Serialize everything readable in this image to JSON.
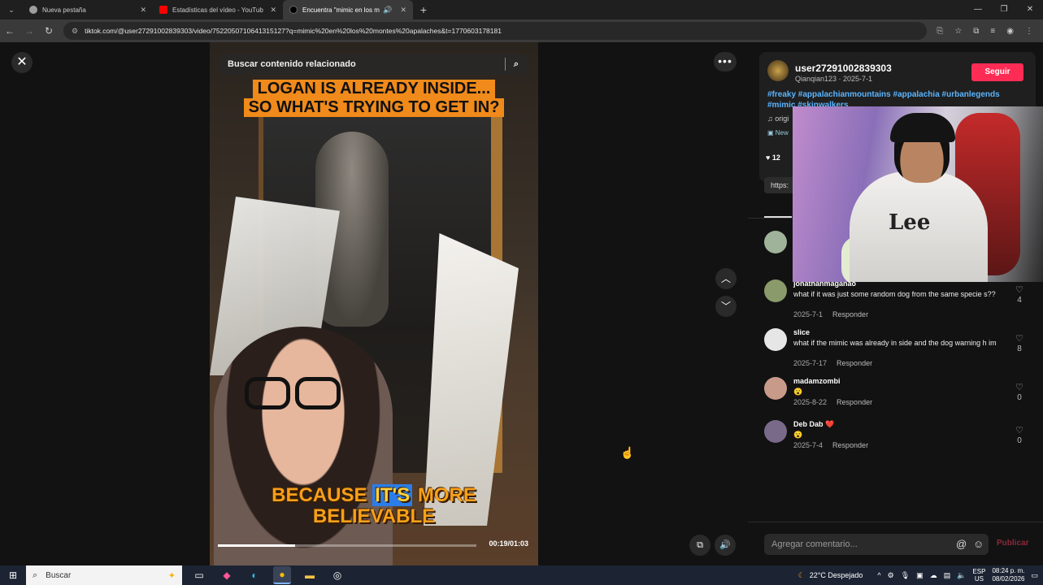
{
  "browser": {
    "tabs": [
      {
        "title": "Nueva pestaña",
        "close": "✕",
        "favicon_color": "#9e9e9e",
        "active": false
      },
      {
        "title": "Estadísticas del vídeo - YouTub",
        "close": "✕",
        "favicon_color": "#ff0000",
        "active": false
      },
      {
        "title": "Encuentra \"mimic en los mo",
        "close": "✕",
        "favicon_color": "#000000",
        "active": true
      }
    ],
    "new_tab": "+",
    "url": "tiktok.com/@user27291002839303/video/7522050710641315127?q=mimic%20en%20los%20montes%20apalaches&t=1770603178181"
  },
  "video": {
    "search_placeholder": "Buscar contenido relacionado",
    "caption_top_line1": "LOGAN IS ALREADY INSIDE...",
    "caption_top_line2": "SO WHAT'S TRYING TO GET IN?",
    "caption_bottom_a": "BECAUSE",
    "caption_bottom_hl": "IT'S",
    "caption_bottom_b": "MORE",
    "caption_bottom_line2": "BELIEVABLE",
    "timecode": "00:19/01:03",
    "progress": 0.3
  },
  "author": {
    "username": "user27291002839303",
    "subtitle": "Qianqian123 · 2025-7-1",
    "follow_label": "Seguir",
    "hashtags_line1": "#freaky #appalachianmountains #appalachia #urbanlegends",
    "hashtags_line2": "#mimic #skinwalkers",
    "music": "origi",
    "new_label": "New",
    "likes": "12",
    "link": "https:"
  },
  "comments": [
    {
      "name": "jonathanmaganao",
      "text": "what if it was just some random dog from the same specie s??",
      "date": "2025-7-1",
      "reply": "Responder",
      "likes": "4",
      "avatar": "#8a9a6a"
    },
    {
      "name": "slice",
      "text": "what if the mimic was already in side and the dog warning h im",
      "date": "2025-7-17",
      "reply": "Responder",
      "likes": "8",
      "avatar": "#e6e6e6"
    },
    {
      "name": "madamzombi",
      "text": "😮",
      "date": "2025-8-22",
      "reply": "Responder",
      "likes": "0",
      "avatar": "#c89a8a"
    },
    {
      "name": "Deb Dab ❤️",
      "text": "😮",
      "date": "2025-7-4",
      "reply": "Responder",
      "likes": "0",
      "avatar": "#7a6a8a"
    }
  ],
  "comment_input": {
    "placeholder": "Agregar comentario...",
    "publish": "Publicar"
  },
  "taskbar": {
    "search": "Buscar",
    "weather": "22°C  Despejado",
    "lang_1": "ESP",
    "lang_2": "US",
    "time": "08:24 p. m.",
    "date": "08/02/2026"
  },
  "colors": {
    "accent": "#fe2c55",
    "hashtag": "#5bb5ff",
    "caption_orange": "#f08a1a"
  }
}
